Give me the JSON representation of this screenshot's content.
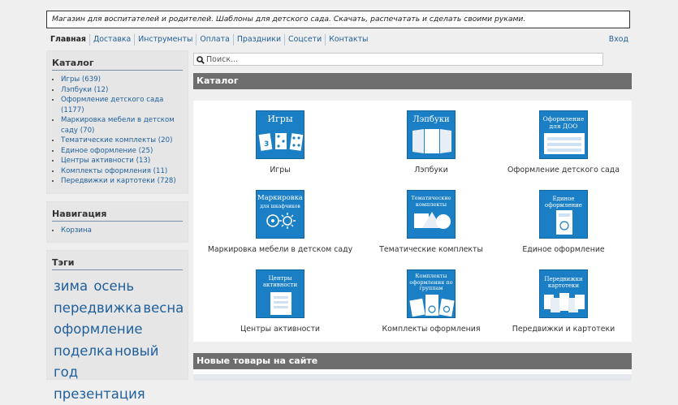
{
  "header": {
    "banner_text": "Магазин для воспитателей и родителей. Шаблоны для детского сада. Скачать, распечатать и сделать своими руками."
  },
  "topnav": {
    "items": [
      {
        "label": "Главная"
      },
      {
        "label": "Доставка"
      },
      {
        "label": "Инструменты"
      },
      {
        "label": "Оплата"
      },
      {
        "label": "Праздники"
      },
      {
        "label": "Соцсети"
      },
      {
        "label": "Контакты"
      }
    ],
    "login_label": "Вход"
  },
  "sidebar": {
    "catalog": {
      "title": "Каталог",
      "items": [
        {
          "label": "Игры (639)"
        },
        {
          "label": "Лэпбуки (12)"
        },
        {
          "label": "Оформление детского сада (1177)"
        },
        {
          "label": "Маркировка мебели в детском саду (70)"
        },
        {
          "label": "Тематические комплекты (20)"
        },
        {
          "label": "Единое оформление (25)"
        },
        {
          "label": "Центры активности (13)"
        },
        {
          "label": "Комплекты оформления (11)"
        },
        {
          "label": "Передвижки и картотеки (728)"
        }
      ]
    },
    "navigation": {
      "title": "Навигация",
      "items": [
        {
          "label": "Корзина"
        }
      ]
    },
    "tags": {
      "title": "Тэги",
      "items": [
        "зима",
        "осень",
        "передвижка",
        "весна",
        "оформление",
        "поделка",
        "новый год",
        "презентация"
      ]
    }
  },
  "search": {
    "placeholder": "Поиск..."
  },
  "main": {
    "catalog_heading": "Каталог",
    "tiles": [
      {
        "label": "Игры",
        "icon_text": "Игры"
      },
      {
        "label": "Лэпбуки",
        "icon_text": "Лэпбуки"
      },
      {
        "label": "Оформление детского сада",
        "icon_text": "Оформление для ДОО"
      },
      {
        "label": "Маркировка мебели в детском саду",
        "icon_text": "Маркировка",
        "icon_subtext": "для шкафчиков"
      },
      {
        "label": "Тематические комплекты",
        "icon_text": "Тематические комплекты"
      },
      {
        "label": "Единое оформление",
        "icon_text": "Единое оформление"
      },
      {
        "label": "Центры активности",
        "icon_text": "Центры активности"
      },
      {
        "label": "Комплекты оформления",
        "icon_text": "Комплекты оформления по группам"
      },
      {
        "label": "Передвижки и картотеки",
        "icon_text": "Передвижки картотеки"
      }
    ],
    "new_products_heading": "Новые товары на сайте"
  },
  "colors": {
    "link": "#1f5f9b",
    "tile_icon_bg": "#1b7fc6",
    "section_bar": "#6e6e6e",
    "page_bg": "#efefef"
  }
}
